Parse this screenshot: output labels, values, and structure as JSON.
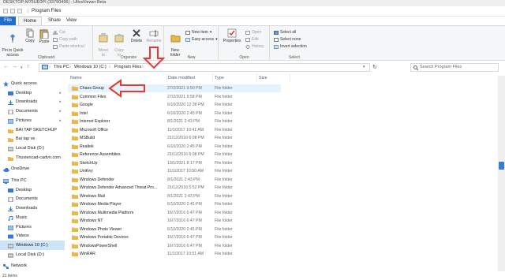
{
  "window": {
    "title": "DESKTOP-M75UE0PI (33790495) - UltraViewer Beta"
  },
  "quick_access_toolbar": {
    "separator": "|",
    "folder_title": "Program Files"
  },
  "ribbon_tabs": [
    {
      "label": "File",
      "active": false
    },
    {
      "label": "Home",
      "active": true
    },
    {
      "label": "Share",
      "active": false
    },
    {
      "label": "View",
      "active": false
    }
  ],
  "ribbon": {
    "clipboard": {
      "label": "Clipboard",
      "pin_quick_access": "Pin to Quick\naccess",
      "copy": "Copy",
      "paste": "Paste",
      "cut": "Cut",
      "copy_path": "Copy path",
      "paste_shortcut": "Paste shortcut"
    },
    "organize": {
      "label": "Organize",
      "move_to": "Move\nto",
      "copy_to": "Copy\nto",
      "delete": "Delete",
      "rename": "Rename"
    },
    "new": {
      "label": "New",
      "new_folder": "New\nfolder",
      "new_item": "New item",
      "easy_access": "Easy access"
    },
    "open": {
      "label": "Open",
      "properties": "Properties",
      "open": "Open",
      "edit": "Edit",
      "history": "History"
    },
    "select": {
      "label": "Select",
      "select_all": "Select all",
      "select_none": "Select none",
      "invert_selection": "Invert selection"
    }
  },
  "address_bar": {
    "crumbs": [
      "This PC",
      "Windows 10 (C:)",
      "Program Files"
    ],
    "search_placeholder": "Search Program Files"
  },
  "nav_pane": {
    "items": [
      {
        "label": "Quick access",
        "level": 0,
        "icon": "star-icon",
        "pinned": false
      },
      {
        "label": "Desktop",
        "level": 1,
        "icon": "desktop-icon",
        "pinned": true
      },
      {
        "label": "Downloads",
        "level": 1,
        "icon": "download-icon",
        "pinned": true
      },
      {
        "label": "Documents",
        "level": 1,
        "icon": "document-icon",
        "pinned": true
      },
      {
        "label": "Pictures",
        "level": 1,
        "icon": "pictures-icon",
        "pinned": true
      },
      {
        "label": "BAI TAP SKETCHUP",
        "level": 1,
        "icon": "folder-icon",
        "pinned": false
      },
      {
        "label": "Bai tap ve",
        "level": 1,
        "icon": "folder-icon",
        "pinned": false
      },
      {
        "label": "Local Disk (D:)",
        "level": 1,
        "icon": "drive-icon",
        "pinned": false
      },
      {
        "label": "Thuviencad-cadvn.com",
        "level": 1,
        "icon": "folder-icon",
        "pinned": false
      },
      {
        "label": "OneDrive",
        "level": 0,
        "icon": "cloud-icon",
        "pinned": false
      },
      {
        "label": "This PC",
        "level": 0,
        "icon": "pc-icon",
        "pinned": false
      },
      {
        "label": "Desktop",
        "level": 1,
        "icon": "desktop-icon",
        "pinned": false
      },
      {
        "label": "Documents",
        "level": 1,
        "icon": "document-icon",
        "pinned": false
      },
      {
        "label": "Downloads",
        "level": 1,
        "icon": "download-icon",
        "pinned": false
      },
      {
        "label": "Music",
        "level": 1,
        "icon": "music-icon",
        "pinned": false
      },
      {
        "label": "Pictures",
        "level": 1,
        "icon": "pictures-icon",
        "pinned": false
      },
      {
        "label": "Videos",
        "level": 1,
        "icon": "video-icon",
        "pinned": false
      },
      {
        "label": "Windows 10 (C:)",
        "level": 1,
        "icon": "drive-icon",
        "pinned": false,
        "selected": true
      },
      {
        "label": "Local Disk (D:)",
        "level": 1,
        "icon": "drive-icon",
        "pinned": false
      },
      {
        "label": "Network",
        "level": 0,
        "icon": "network-icon",
        "pinned": false
      }
    ]
  },
  "file_list": {
    "columns": {
      "name": "Name",
      "date": "Date modified",
      "type": "Type",
      "size": "Size"
    },
    "rows": [
      {
        "name": "Chaos Group",
        "date": "27/2/2021 9:50 PM",
        "type": "File folder",
        "highlighted": true
      },
      {
        "name": "Common Files",
        "date": "27/2/2021 9:58 PM",
        "type": "File folder"
      },
      {
        "name": "Google",
        "date": "6/10/2020 12:38 PM",
        "type": "File folder"
      },
      {
        "name": "Intel",
        "date": "6/10/2020 2:45 PM",
        "type": "File folder"
      },
      {
        "name": "Internet Explorer",
        "date": "8/1/2021 2:43 PM",
        "type": "File folder"
      },
      {
        "name": "Microsoft Office",
        "date": "11/1/2017 10:41 AM",
        "type": "File folder"
      },
      {
        "name": "MSBuild",
        "date": "21/12/2016 6:08 PM",
        "type": "File folder"
      },
      {
        "name": "Realtek",
        "date": "6/10/2020 2:45 PM",
        "type": "File folder"
      },
      {
        "name": "Reference Assemblies",
        "date": "21/12/2016 6:08 PM",
        "type": "File folder"
      },
      {
        "name": "SketchUp",
        "date": "13/1/2021 8:17 PM",
        "type": "File folder"
      },
      {
        "name": "UniKey",
        "date": "11/1/2017 10:50 AM",
        "type": "File folder"
      },
      {
        "name": "Windows Defender",
        "date": "8/1/2021 2:43 PM",
        "type": "File folder"
      },
      {
        "name": "Windows Defender Advanced Threat Pro...",
        "date": "21/12/2016 5:52 PM",
        "type": "File folder"
      },
      {
        "name": "Windows Mail",
        "date": "8/1/2021 2:43 PM",
        "type": "File folder"
      },
      {
        "name": "Windows Media Player",
        "date": "6/10/2020 2:45 PM",
        "type": "File folder"
      },
      {
        "name": "Windows Multimedia Platform",
        "date": "16/7/2016 6:47 PM",
        "type": "File folder"
      },
      {
        "name": "Windows NT",
        "date": "16/7/2016 6:47 PM",
        "type": "File folder"
      },
      {
        "name": "Windows Photo Viewer",
        "date": "6/10/2020 2:45 PM",
        "type": "File folder"
      },
      {
        "name": "Windows Portable Devices",
        "date": "16/7/2016 6:47 PM",
        "type": "File folder"
      },
      {
        "name": "WindowsPowerShell",
        "date": "16/7/2016 6:47 PM",
        "type": "File folder"
      },
      {
        "name": "WinRAR",
        "date": "11/1/2017 10:51 AM",
        "type": "File folder"
      }
    ]
  },
  "status_bar": {
    "item_count": "21 items"
  },
  "colors": {
    "accent": "#1f6fd1",
    "selection": "#cce4f7",
    "hover": "#e5f3ff",
    "folder": "#e8b84a",
    "annotation_red": "#e53935"
  }
}
